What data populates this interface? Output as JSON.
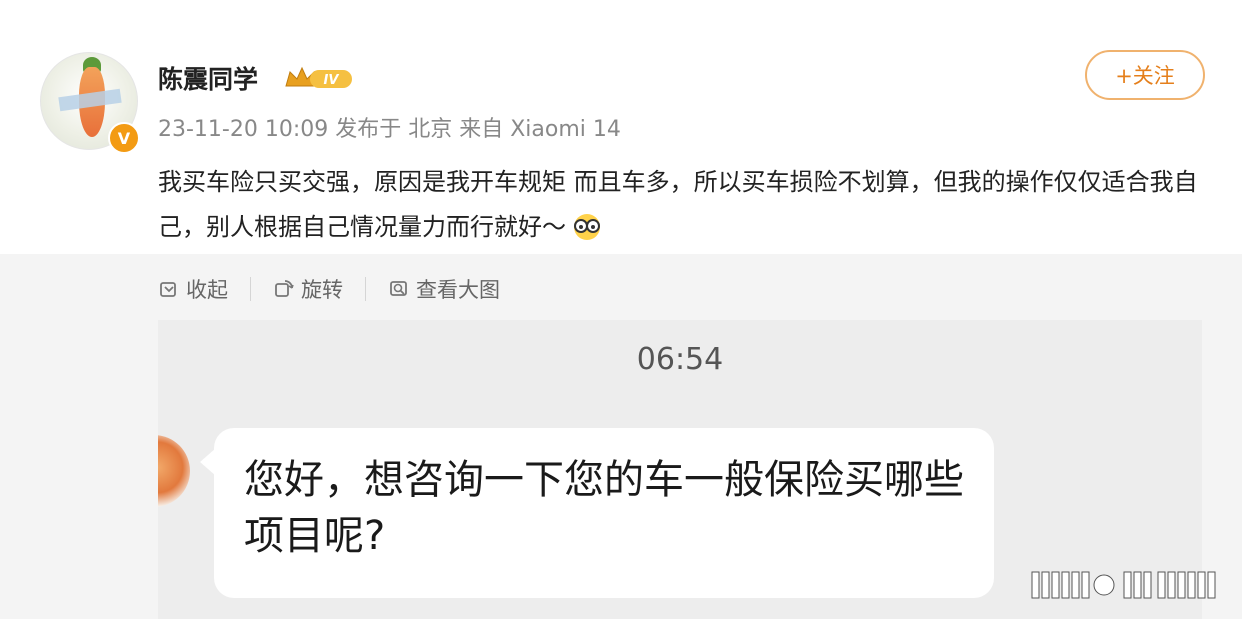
{
  "post": {
    "username": "陈震同学",
    "level_badge": "IV",
    "verified_badge": "V",
    "meta": "23-11-20 10:09 发布于 北京 来自 Xiaomi 14",
    "follow_label": "+关注",
    "text": "我买车险只买交强，原因是我开车规矩 而且车多，所以买车损险不划算，但我的操作仅仅适合我自己，别人根据自己情况量力而行就好～",
    "emoji_icon": "nerd-glasses-emoji"
  },
  "toolbar": {
    "collapse_label": "收起",
    "rotate_label": "旋转",
    "view_large_label": "查看大图"
  },
  "chat_image": {
    "time": "06:54",
    "message": "您好，想咨询一下您的车一般保险买哪些项目呢?"
  },
  "colors": {
    "accent_orange": "#e57f1b",
    "follow_border": "#f0b26e",
    "badge_orange": "#f39b13",
    "meta_gray": "#888888"
  }
}
